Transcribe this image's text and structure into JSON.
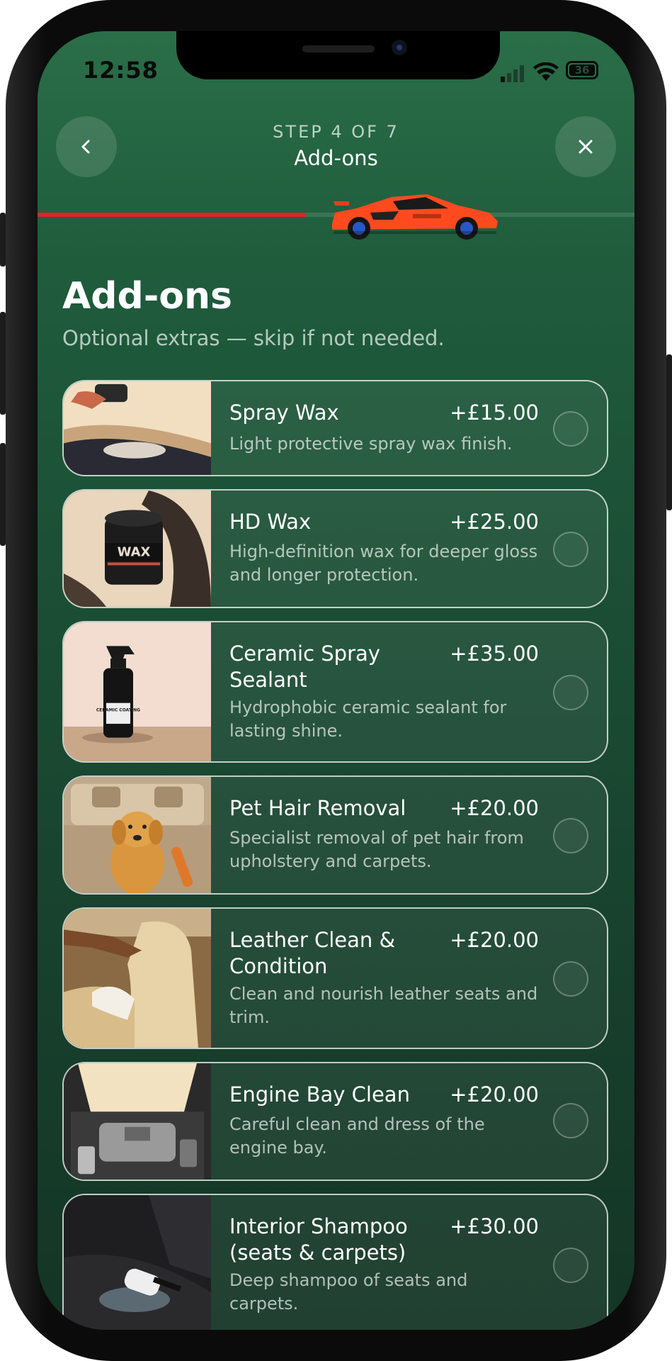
{
  "status_bar": {
    "time": "12:58",
    "battery": "36"
  },
  "header": {
    "step": "STEP 4 OF 7",
    "title": "Add-ons",
    "back_icon": "chevron-left-icon",
    "close_icon": "close-icon",
    "progress": 0.45
  },
  "colors": {
    "accent": "#e0232b",
    "background": "#1b4d34",
    "car": "#ff4a1f"
  },
  "page": {
    "title": "Add-ons",
    "subtitle": "Optional extras — skip if not needed."
  },
  "addons": [
    {
      "title": "Spray Wax",
      "price": "+£15.00",
      "description": "Light protective spray wax finish.",
      "selected": false
    },
    {
      "title": "HD Wax",
      "price": "+£25.00",
      "description": "High-definition wax for deeper gloss and longer protection.",
      "selected": false
    },
    {
      "title": "Ceramic Spray Sealant",
      "price": "+£35.00",
      "description": "Hydrophobic ceramic sealant for lasting shine.",
      "selected": false
    },
    {
      "title": "Pet Hair Removal",
      "price": "+£20.00",
      "description": "Specialist removal of pet hair from upholstery and carpets.",
      "selected": false
    },
    {
      "title": "Leather Clean & Condition",
      "price": "+£20.00",
      "description": "Clean and nourish leather seats and trim.",
      "selected": false
    },
    {
      "title": "Engine Bay Clean",
      "price": "+£20.00",
      "description": "Careful clean and dress of the engine bay.",
      "selected": false
    },
    {
      "title": "Interior Shampoo (seats & carpets)",
      "price": "+£30.00",
      "description": "Deep shampoo of seats and carpets.",
      "selected": false
    }
  ],
  "product_labels": {
    "wax_jar": "WAX",
    "ceramic_bottle": "CERAMIC COATING"
  }
}
